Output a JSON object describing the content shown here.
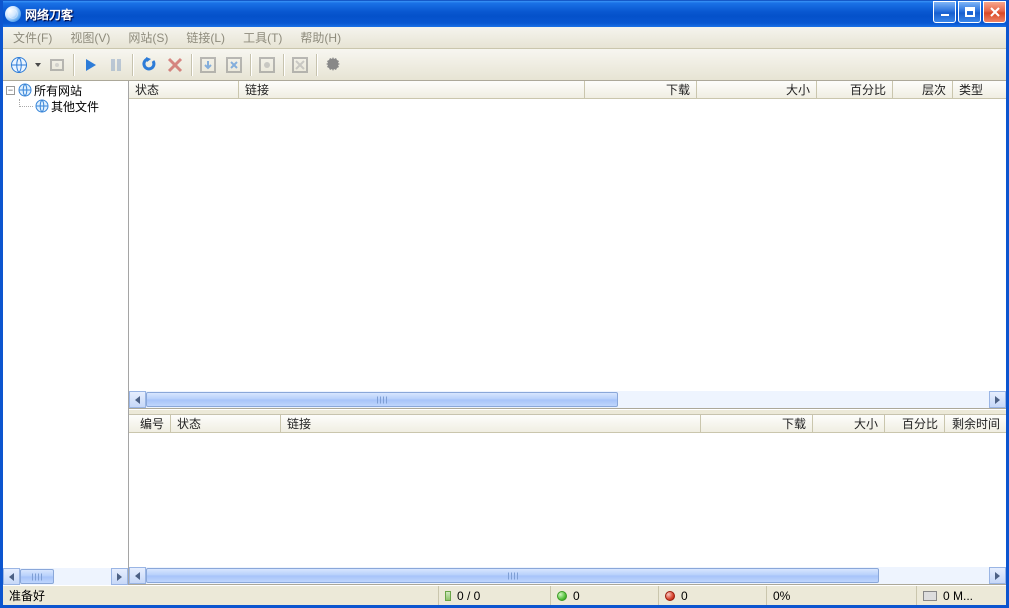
{
  "window": {
    "title": "网络刀客"
  },
  "menubar": {
    "file": {
      "label": "文件",
      "hotkey": "(F)"
    },
    "view": {
      "label": "视图",
      "hotkey": "(V)"
    },
    "site": {
      "label": "网站",
      "hotkey": "(S)"
    },
    "link": {
      "label": "链接",
      "hotkey": "(L)"
    },
    "tools": {
      "label": "工具",
      "hotkey": "(T)"
    },
    "help": {
      "label": "帮助",
      "hotkey": "(H)"
    }
  },
  "tree": {
    "root_label": "所有网站",
    "child_label": "其他文件"
  },
  "upper_columns": {
    "status": "状态",
    "link": "链接",
    "download": "下载",
    "size": "大小",
    "percent": "百分比",
    "level": "层次",
    "type": "类型"
  },
  "lower_columns": {
    "no": "编号",
    "status": "状态",
    "link": "链接",
    "download": "下载",
    "size": "大小",
    "percent": "百分比",
    "remain": "剩余时间"
  },
  "status": {
    "ready": "准备好",
    "counter": "0 / 0",
    "green": "0",
    "red": "0",
    "pct": "0%",
    "net": "0 M..."
  }
}
